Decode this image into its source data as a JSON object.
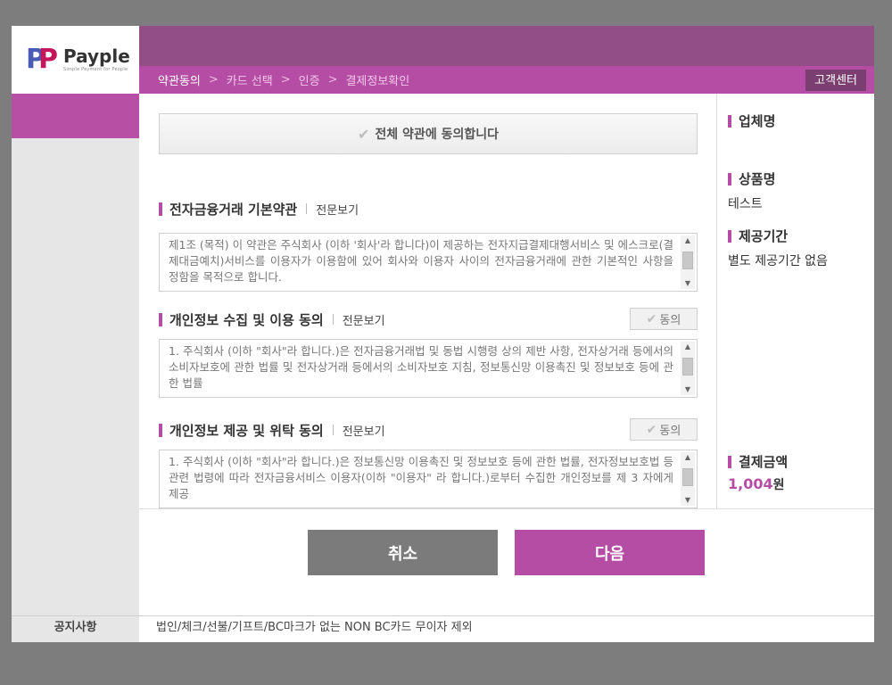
{
  "brand": {
    "name": "Payple",
    "tagline": "Simple Payment for People",
    "accent": "#b54da5",
    "dark": "#924e86"
  },
  "breadcrumb": [
    "약관동의",
    "카드 선택",
    "인증",
    "결제정보확인"
  ],
  "support_label": "고객센터",
  "agree_all_label": "전체 약관에 동의합니다",
  "sections": [
    {
      "title": "전자금융거래 기본약관",
      "link": "전문보기",
      "text": "제1조 (목적) 이 약관은 주식회사        (이하 '회사'라 합니다)이 제공하는 전자지급결제대행서비스 및 에스크로(결제대금예치)서비스를 이용자가 이용함에 있어 회사와 이용자 사이의 전자금융거래에 관한 기본적인 사항을 정함을 목적으로 합니다."
    },
    {
      "title": "개인정보 수집 및 이용 동의",
      "link": "전문보기",
      "agree_label": "동의",
      "text": "1. 주식회사       (이하 \"회사\"라 합니다.)은 전자금융거래법 및 동법 시행령 상의 제반 사항, 전자상거래 등에서의 소비자보호에 관한 법률 및 전자상거래 등에서의 소비자보호 지침, 정보통신망 이용촉진 및 정보보호 등에 관한 법률"
    },
    {
      "title": "개인정보 제공 및 위탁 동의",
      "link": "전문보기",
      "agree_label": "동의",
      "text": "1. 주식회사        (이하 \"회사\"라 합니다.)은 정보통신망 이용촉진 및 정보보호 등에 관한 법률, 전자정보보호법 등 관련 법령에 따라 전자금융서비스 이용자(이하 \"이용자\" 라 합니다.)로부터 수집한 개인정보를 제 3 자에게 제공"
    }
  ],
  "info": {
    "merchant_label": "업체명",
    "merchant_value": "",
    "product_label": "상품명",
    "product_value": "테스트",
    "period_label": "제공기간",
    "period_value": "별도 제공기간 없음",
    "amount_label": "결제금액",
    "amount_value": "1,004",
    "amount_unit": "원"
  },
  "buttons": {
    "cancel": "취소",
    "next": "다음"
  },
  "notice": {
    "label": "공지사항",
    "text": "법인/체크/선불/기프트/BC마크가 없는 NON BC카드 무이자 제외"
  }
}
